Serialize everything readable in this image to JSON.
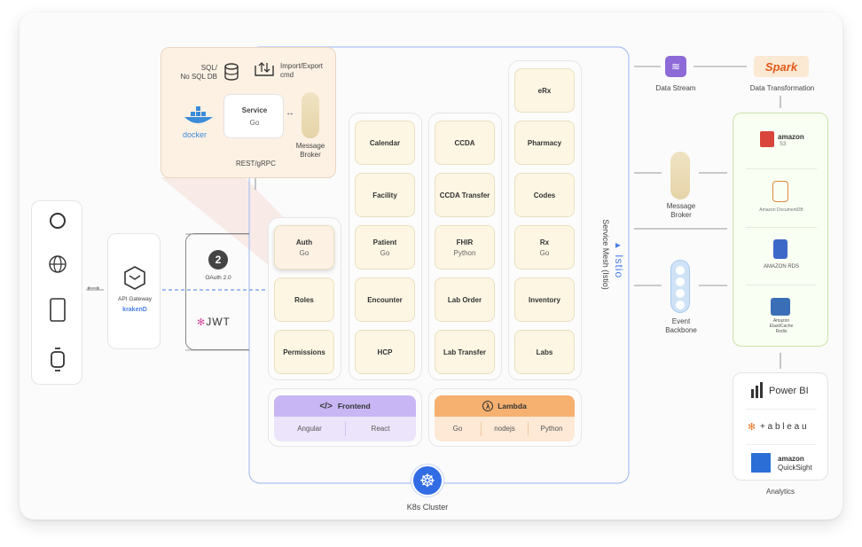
{
  "clients": {
    "icons": [
      "alexa-icon",
      "globe-icon",
      "tablet-icon",
      "watch-icon"
    ]
  },
  "gateway": {
    "label": "API Gateway",
    "brand": "krakenD"
  },
  "auth_provider": {
    "oauth_label": "OAuth 2.0",
    "jwt_label": "JWT"
  },
  "top_zoom": {
    "db_label": "SQL/\nNo SQL DB",
    "import_label": "Import/Export\ncmd",
    "service_title": "Service",
    "service_sub": "Go",
    "broker_label": "Message\nBroker",
    "rest_label": "REST/gRPC",
    "docker_label": "docker"
  },
  "columns": {
    "col1": [
      {
        "title": "Auth",
        "sub": "Go"
      },
      {
        "title": "Roles",
        "sub": ""
      },
      {
        "title": "Permissions",
        "sub": ""
      }
    ],
    "col2": [
      {
        "title": "Calendar",
        "sub": ""
      },
      {
        "title": "Facility",
        "sub": ""
      },
      {
        "title": "Patient",
        "sub": "Go"
      },
      {
        "title": "Encounter",
        "sub": ""
      },
      {
        "title": "HCP",
        "sub": ""
      }
    ],
    "col3": [
      {
        "title": "CCDA",
        "sub": ""
      },
      {
        "title": "CCDA Transfer",
        "sub": ""
      },
      {
        "title": "FHIR",
        "sub": "Python"
      },
      {
        "title": "Lab Order",
        "sub": ""
      },
      {
        "title": "Lab Transfer",
        "sub": ""
      }
    ],
    "col4": [
      {
        "title": "eRx",
        "sub": ""
      },
      {
        "title": "Pharmacy",
        "sub": ""
      },
      {
        "title": "Codes",
        "sub": ""
      },
      {
        "title": "Rx",
        "sub": "Go"
      },
      {
        "title": "Inventory",
        "sub": ""
      },
      {
        "title": "Labs",
        "sub": ""
      }
    ]
  },
  "frontend": {
    "title": "Frontend",
    "items": [
      "Angular",
      "React"
    ]
  },
  "lambda": {
    "title": "Lambda",
    "items": [
      "Go",
      "nodejs",
      "Python"
    ]
  },
  "mesh": {
    "label": "Service Mesh (Istio)",
    "brand": "Istio"
  },
  "k8s": {
    "label": "K8s Cluster"
  },
  "right": {
    "data_stream": "Data Stream",
    "spark": "Spark",
    "data_transformation": "Data Transformation",
    "message_broker": "Message\nBroker",
    "event_backbone": "Event\nBackbone",
    "storage": {
      "s3_brand": "amazon",
      "s3_sub": "S3",
      "docdb": "Amazon DocumentDB",
      "rds": "AMAZON RDS",
      "elasticache": "Amazon\nElastiCache\nRedis"
    },
    "analytics": {
      "powerbi": "Power BI",
      "tableau": "+ a b l e a u",
      "quicksight_brand": "amazon",
      "quicksight_sub": "QuickSight",
      "label": "Analytics"
    }
  },
  "colors": {
    "accent_blue": "#4a7fe8",
    "frontend_purple": "#c8b6f4",
    "lambda_orange": "#f6b06f",
    "service_cream": "#fdf6e3",
    "storage_green": "#c9e3a8"
  }
}
